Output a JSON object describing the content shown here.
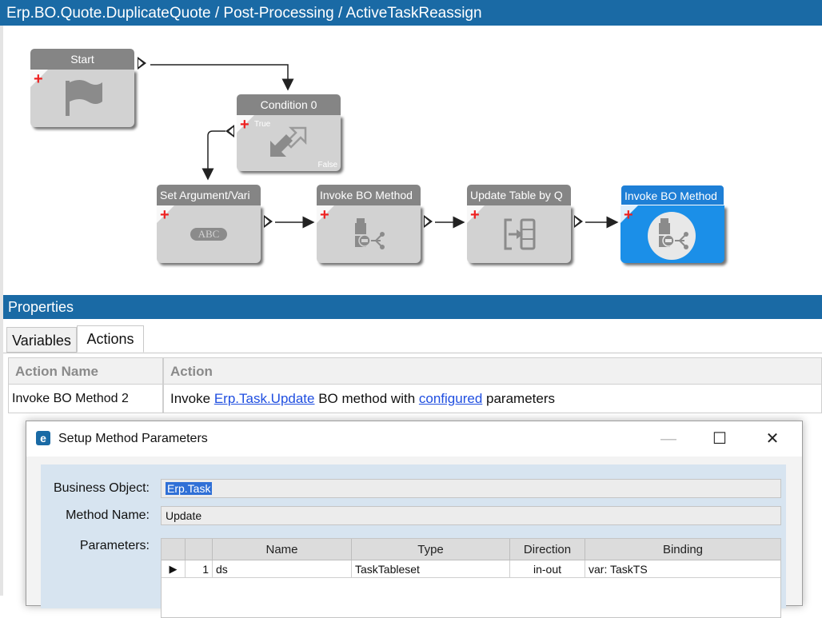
{
  "window": {
    "title": "Erp.BO.Quote.DuplicateQuote / Post-Processing / ActiveTaskReassign"
  },
  "workflow": {
    "nodes": {
      "start": {
        "label": "Start",
        "icon": "flag-icon"
      },
      "condition": {
        "label": "Condition 0",
        "true_label": "True",
        "false_label": "False",
        "icon": "condition-arrows-icon"
      },
      "set_argument": {
        "label": "Set Argument/Vari",
        "icon": "abc-icon",
        "icon_text": "ABC"
      },
      "invoke1": {
        "label": "Invoke BO Method",
        "icon": "invoke-method-icon"
      },
      "update_table": {
        "label": "Update Table by Q",
        "icon": "update-table-icon"
      },
      "invoke2": {
        "label": "Invoke BO Method",
        "icon": "invoke-method-icon",
        "selected": true
      }
    },
    "colors": {
      "node_header": "#858585",
      "node_body": "#d2d2d2",
      "selected": "#1b8fe8",
      "plus": "#e22222"
    }
  },
  "properties": {
    "title": "Properties",
    "tabs": [
      "Variables",
      "Actions"
    ],
    "active_tab": "Actions",
    "grid": {
      "headers": [
        "Action Name",
        "Action"
      ],
      "row": {
        "name": "Invoke BO Method 2",
        "action_prefix": "Invoke ",
        "action_link1": "Erp.Task.Update",
        "action_middle": " BO method with ",
        "action_link2": "configured",
        "action_suffix": " parameters"
      }
    }
  },
  "dialog": {
    "title": "Setup Method Parameters",
    "icon_letter": "e",
    "minimize_glyph": "—",
    "maximize_glyph": "☐",
    "close_glyph": "✕",
    "business_object_label": "Business Object:",
    "business_object": "Erp.Task",
    "method_name_label": "Method Name:",
    "method_name": "Update",
    "parameters_label": "Parameters:",
    "table": {
      "headers": [
        "Name",
        "Type",
        "Direction",
        "Binding"
      ],
      "row": {
        "marker": "▶",
        "index": "1",
        "name": "ds",
        "type": "TaskTableset",
        "direction": "in-out",
        "binding": "var: TaskTS"
      }
    }
  }
}
